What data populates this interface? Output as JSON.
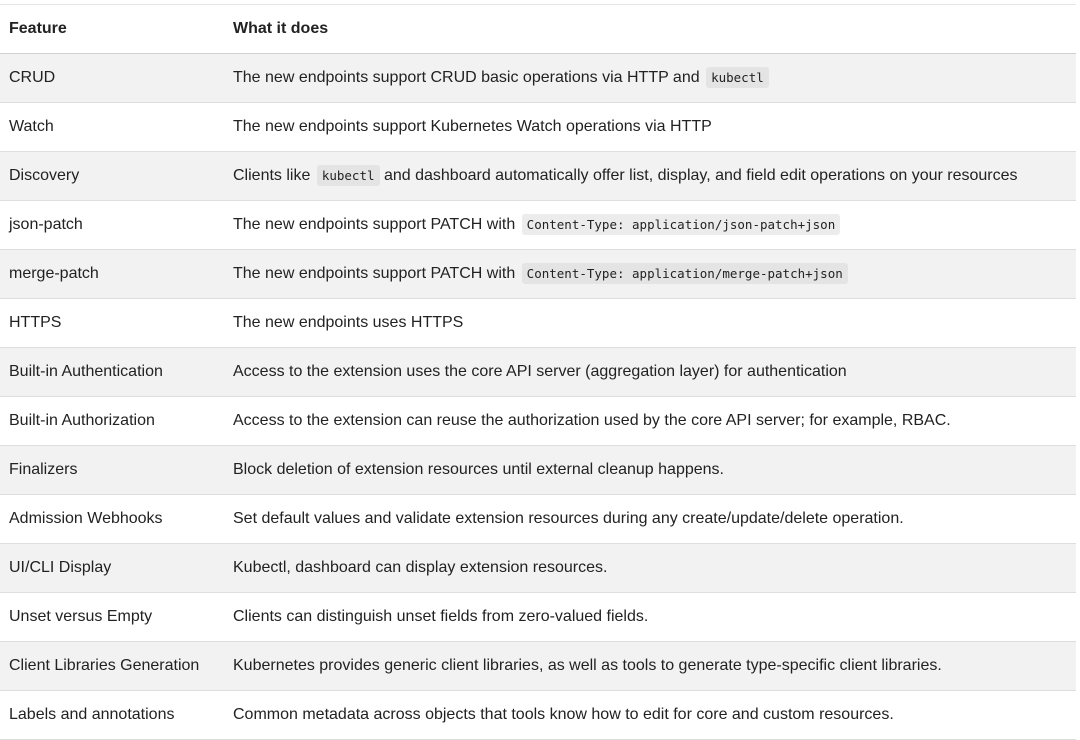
{
  "header": {
    "col1": "Feature",
    "col2": "What it does"
  },
  "rows": [
    {
      "feature": "CRUD",
      "pre": "The new endpoints support CRUD basic operations via HTTP and",
      "code": "kubectl",
      "post": ""
    },
    {
      "feature": "Watch",
      "pre": "The new endpoints support Kubernetes Watch operations via HTTP",
      "code": "",
      "post": ""
    },
    {
      "feature": "Discovery",
      "pre": "Clients like",
      "code": "kubectl",
      "post": "and dashboard automatically offer list, display, and field edit operations on your resources"
    },
    {
      "feature": "json-patch",
      "pre": "The new endpoints support PATCH with",
      "code": "Content-Type: application/json-patch+json",
      "post": ""
    },
    {
      "feature": "merge-patch",
      "pre": "The new endpoints support PATCH with",
      "code": "Content-Type: application/merge-patch+json",
      "post": ""
    },
    {
      "feature": "HTTPS",
      "pre": "The new endpoints uses HTTPS",
      "code": "",
      "post": ""
    },
    {
      "feature": "Built-in Authentication",
      "pre": "Access to the extension uses the core API server (aggregation layer) for authentication",
      "code": "",
      "post": ""
    },
    {
      "feature": "Built-in Authorization",
      "pre": "Access to the extension can reuse the authorization used by the core API server; for example, RBAC.",
      "code": "",
      "post": ""
    },
    {
      "feature": "Finalizers",
      "pre": "Block deletion of extension resources until external cleanup happens.",
      "code": "",
      "post": ""
    },
    {
      "feature": "Admission Webhooks",
      "pre": "Set default values and validate extension resources during any create/update/delete operation.",
      "code": "",
      "post": ""
    },
    {
      "feature": "UI/CLI Display",
      "pre": "Kubectl, dashboard can display extension resources.",
      "code": "",
      "post": ""
    },
    {
      "feature": "Unset versus Empty",
      "pre": "Clients can distinguish unset fields from zero-valued fields.",
      "code": "",
      "post": ""
    },
    {
      "feature": "Client Libraries Generation",
      "pre": "Kubernetes provides generic client libraries, as well as tools to generate type-specific client libraries.",
      "code": "",
      "post": ""
    },
    {
      "feature": "Labels and annotations",
      "pre": "Common metadata across objects that tools know how to edit for core and custom resources.",
      "code": "",
      "post": ""
    }
  ]
}
